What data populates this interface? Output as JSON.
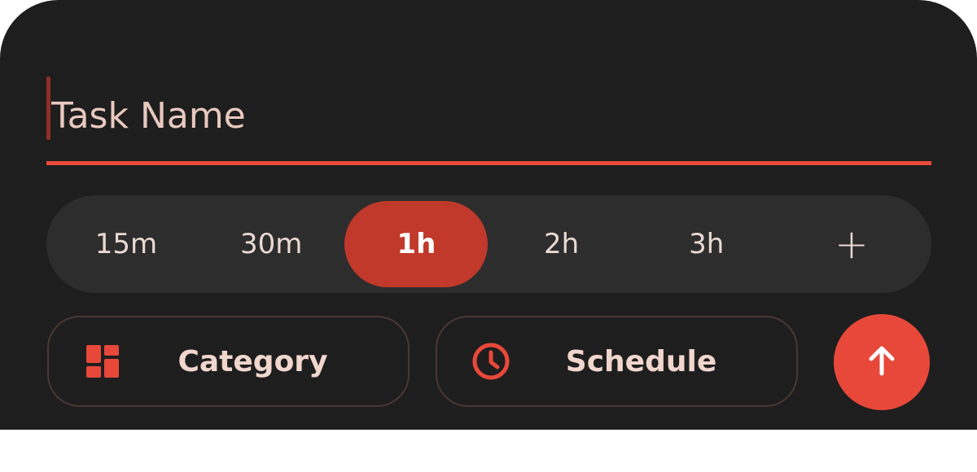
{
  "task": {
    "placeholder": "Task Name",
    "value": ""
  },
  "durations": {
    "options": [
      "15m",
      "30m",
      "1h",
      "2h",
      "3h"
    ],
    "selected": "1h",
    "add_label": "+"
  },
  "actions": {
    "category_label": "Category",
    "category_icon": "grid-icon",
    "schedule_label": "Schedule",
    "schedule_icon": "clock-icon",
    "submit_icon": "arrow-up-icon"
  },
  "colors": {
    "background": "#1f1e1e",
    "accent": "#e8483a",
    "accent_dark": "#c0392b",
    "pill_bg": "#2e2d2d",
    "text": "#ead9d3"
  }
}
